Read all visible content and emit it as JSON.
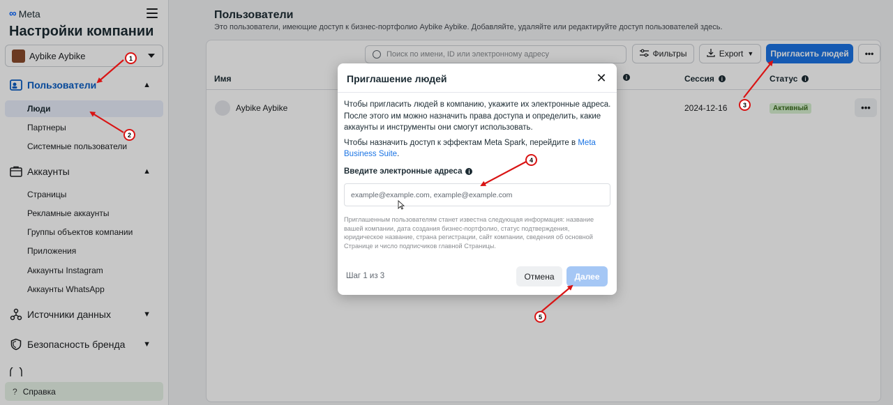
{
  "sidebar": {
    "brand": "Meta",
    "title": "Настройки компании",
    "account": "Aybike Aybike",
    "sections": [
      {
        "label": "Пользователи",
        "items": [
          "Люди",
          "Партнеры",
          "Системные пользователи"
        ]
      },
      {
        "label": "Аккаунты",
        "items": [
          "Страницы",
          "Рекламные аккаунты",
          "Группы объектов компании",
          "Приложения",
          "Аккаунты Instagram",
          "Аккаунты WhatsApp"
        ]
      },
      {
        "label": "Источники данных",
        "items": []
      },
      {
        "label": "Безопасность бренда",
        "items": []
      }
    ],
    "help": "Справка"
  },
  "main": {
    "title": "Пользователи",
    "subtitle": "Это пользователи, имеющие доступ к бизнес-портфолио Aybike Aybike. Добавляйте, удаляйте или редактируйте доступ пользователей здесь.",
    "search_placeholder": "Поиск по имени, ID или электронному адресу",
    "filters_label": "Фильтры",
    "export_label": "Export",
    "invite_label": "Пригласить людей",
    "more_label": "•••",
    "columns": {
      "name": "Имя",
      "session": "Сессия",
      "status": "Статус"
    },
    "row": {
      "name": "Aybike Aybike",
      "session": "2024-12-16",
      "status": "Активный"
    }
  },
  "modal": {
    "title": "Приглашение людей",
    "close": "✕",
    "paragraph1": "Чтобы пригласить людей в компанию, укажите их электронные адреса. После этого им можно назначить права доступа и определить, какие аккаунты и инструменты они смогут использовать.",
    "paragraph2_text": "Чтобы назначить доступ к эффектам Meta Spark, перейдите в ",
    "paragraph2_link": "Meta Business Suite",
    "paragraph2_end": ".",
    "email_label": "Введите электронные адреса",
    "email_placeholder": "example@example.com, example@example.com",
    "note": "Приглашенным пользователям станет известна следующая информация: название вашей компании, дата создания бизнес-портфолио, статус подтверждения, юридическое название, страна регистрации, сайт компании, сведения об основной Странице и число подписчиков главной Страницы.",
    "step": "Шаг 1 из 3",
    "cancel": "Отмена",
    "next": "Далее"
  },
  "markers": [
    "1",
    "2",
    "3",
    "4",
    "5"
  ],
  "colors": {
    "accent": "#1b74e4",
    "annotation": "#d91414",
    "active_badge": "#d7f0d0"
  }
}
